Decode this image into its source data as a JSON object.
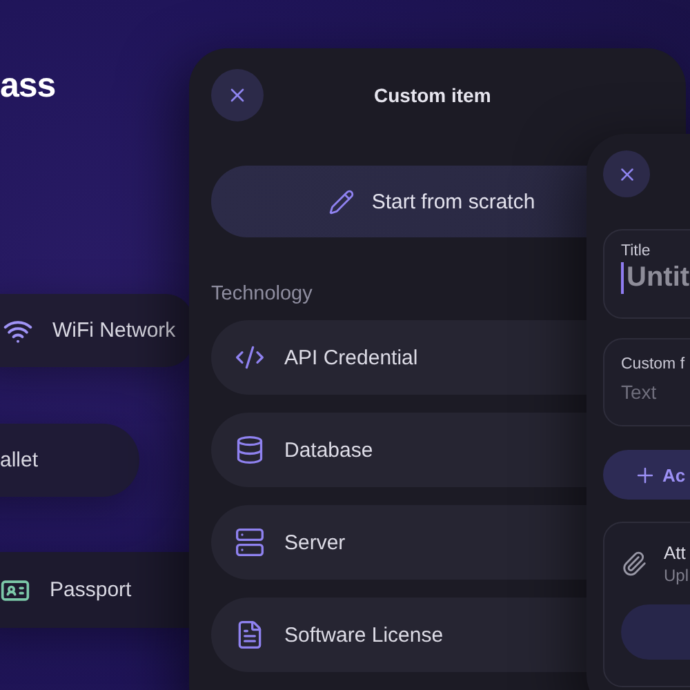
{
  "background": {
    "heading": "ass",
    "items": [
      {
        "kind": "wifi",
        "label": "WiFi Network"
      },
      {
        "kind": "pill",
        "label": "allet"
      },
      {
        "kind": "id-card",
        "label": "Passport"
      }
    ]
  },
  "custom_item": {
    "title": "Custom item",
    "start_button": "Start from scratch",
    "section": "Technology",
    "items": [
      {
        "kind": "code",
        "label": "API Credential"
      },
      {
        "kind": "database",
        "label": "Database"
      },
      {
        "kind": "server",
        "label": "Server"
      },
      {
        "kind": "document",
        "label": "Software License"
      }
    ]
  },
  "editor": {
    "title_field": {
      "label": "Title",
      "value": "Untit"
    },
    "custom_field": {
      "label": "Custom f",
      "placeholder": "Text"
    },
    "add_button": "Ac",
    "attachment": {
      "title": "Att",
      "subtitle": "Upl"
    }
  }
}
